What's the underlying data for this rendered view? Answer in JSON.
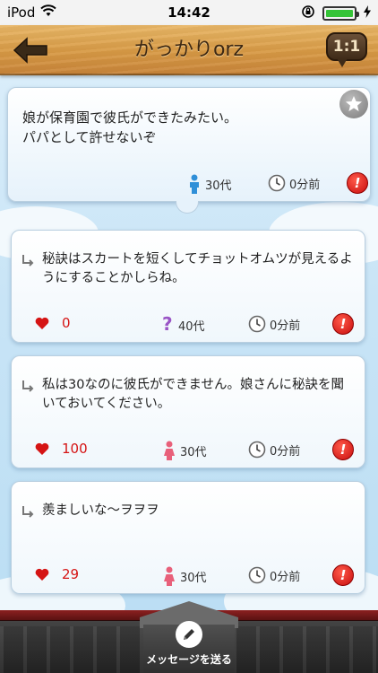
{
  "status_bar": {
    "carrier": "iPod",
    "time": "14:42"
  },
  "nav": {
    "title": "がっかりorz",
    "one_on_one": "1:1"
  },
  "post": {
    "text_line1": "娘が保育園で彼氏ができたみたい。",
    "text_line2": "パパとして許せないぞ",
    "age": "30代",
    "time_ago": "0分前"
  },
  "replies": [
    {
      "text": "秘訣はスカートを短くしてチョットオムツが見えるようにすることかしらね。",
      "likes": "0",
      "age": "40代",
      "time_ago": "0分前",
      "gender_icon": "question-icon"
    },
    {
      "text": "私は30なのに彼氏ができません。娘さんに秘訣を聞いておいてください。",
      "likes": "100",
      "age": "30代",
      "time_ago": "0分前",
      "gender_icon": "female-icon"
    },
    {
      "text": "羨ましいな〜ヲヲヲ",
      "likes": "29",
      "age": "30代",
      "time_ago": "0分前",
      "gender_icon": "female-icon"
    }
  ],
  "bottom": {
    "send_label": "メッセージを送る"
  },
  "colors": {
    "accent_red": "#d51414",
    "wood": "#d89a45",
    "male_blue": "#2f8fd8",
    "female_pink": "#e8607a"
  }
}
